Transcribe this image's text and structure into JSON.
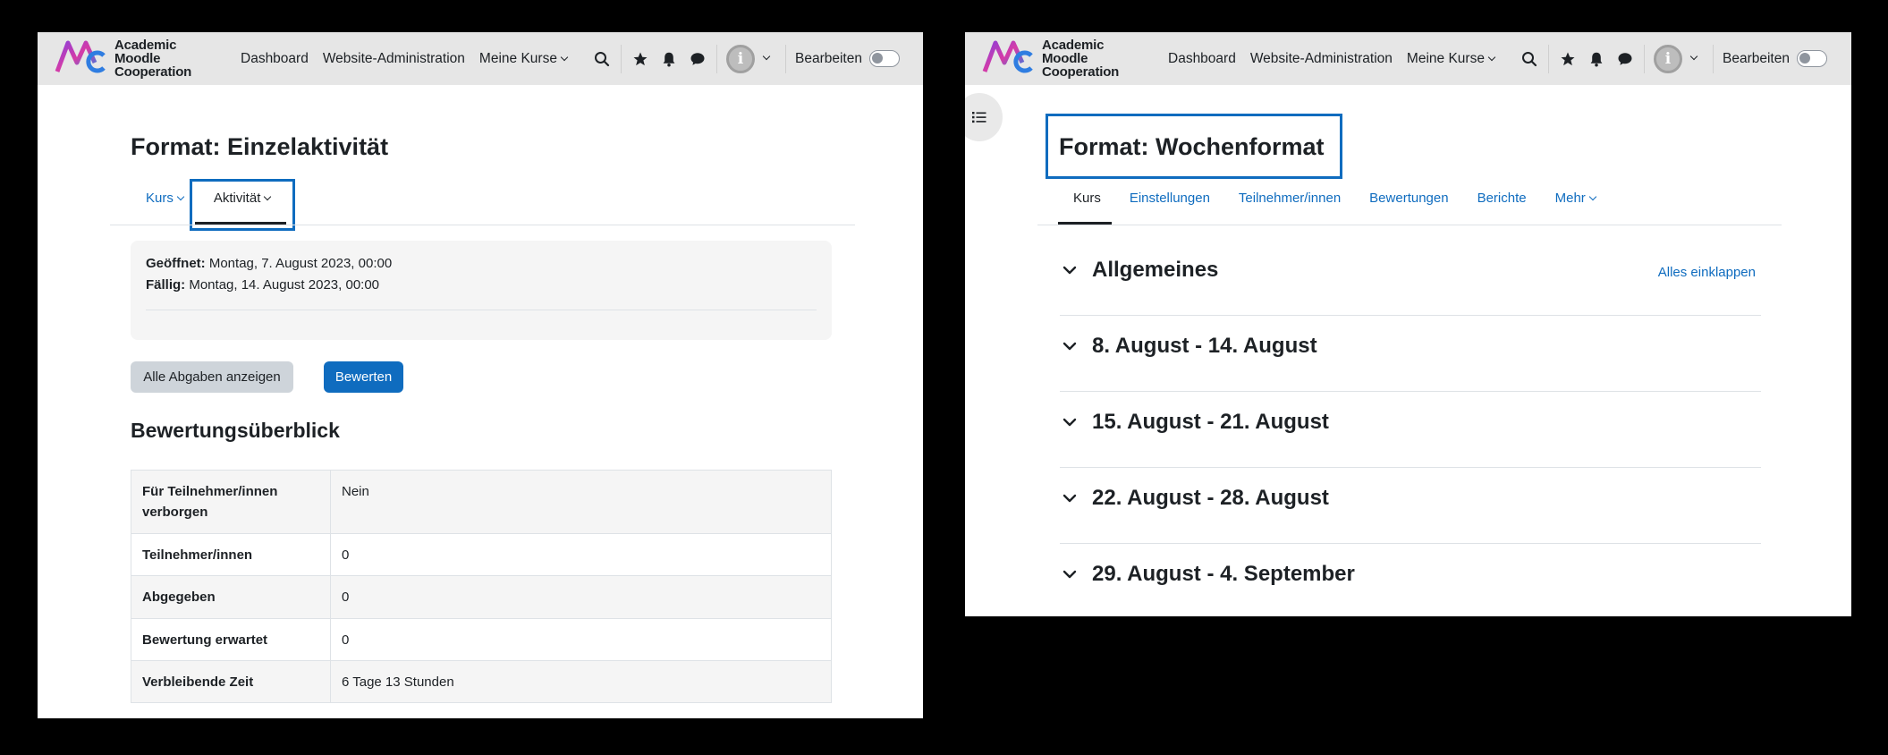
{
  "brand": {
    "logo_text_lines": [
      "Academic",
      "Moodle",
      "Cooperation"
    ],
    "colors": {
      "accent": "#0f6cbf",
      "navbar_bg": "#e6e6e6",
      "logo_gradient": [
        "#8b3fd9",
        "#d63ba7",
        "#2f7de1"
      ]
    }
  },
  "navbar": {
    "links": [
      "Dashboard",
      "Website-Administration",
      "Meine Kurse"
    ],
    "icons": [
      "search-icon",
      "star-icon",
      "bell-icon",
      "chat-icon",
      "user-avatar-icon",
      "chevron-down-icon"
    ],
    "avatar_letter": "i",
    "edit_mode_label": "Bearbeiten"
  },
  "left": {
    "title": "Format: Einzelaktivität",
    "secondary_nav": [
      "Kurs",
      "Aktivität"
    ],
    "dates": [
      {
        "label": "Geöffnet:",
        "value": "Montag, 7. August 2023, 00:00"
      },
      {
        "label": "Fällig:",
        "value": "Montag, 14. August 2023, 00:00"
      }
    ],
    "buttons": {
      "view_all": "Alle Abgaben anzeigen",
      "grade": "Bewerten"
    },
    "grading_heading": "Bewertungsüberblick",
    "grading_rows": [
      {
        "label": "Für Teilnehmer/innen verborgen",
        "value": "Nein"
      },
      {
        "label": "Teilnehmer/innen",
        "value": "0"
      },
      {
        "label": "Abgegeben",
        "value": "0"
      },
      {
        "label": "Bewertung erwartet",
        "value": "0"
      },
      {
        "label": "Verbleibende Zeit",
        "value": "6 Tage 13 Stunden"
      }
    ]
  },
  "right": {
    "title": "Format: Wochenformat",
    "secondary_nav": [
      "Kurs",
      "Einstellungen",
      "Teilnehmer/innen",
      "Bewertungen",
      "Berichte",
      "Mehr"
    ],
    "collapse_all": "Alles einklappen",
    "sections": [
      "Allgemeines",
      "8. August - 14. August",
      "15. August - 21. August",
      "22. August - 28. August",
      "29. August - 4. September"
    ]
  }
}
